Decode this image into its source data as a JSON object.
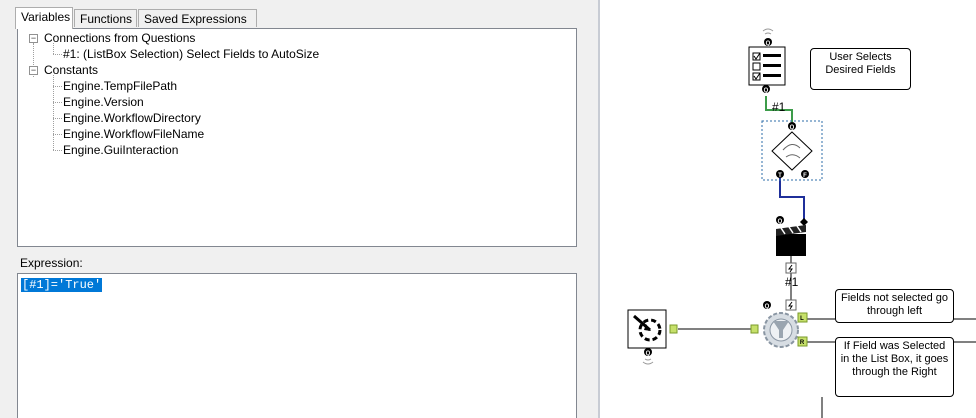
{
  "tabs": [
    {
      "label": "Variables",
      "active": true
    },
    {
      "label": "Functions",
      "active": false
    },
    {
      "label": "Saved Expressions",
      "active": false
    }
  ],
  "tree": {
    "connections_label": "Connections from Questions",
    "connection_item": "#1: (ListBox Selection) Select Fields to AutoSize",
    "constants_label": "Constants",
    "constants": [
      "Engine.TempFilePath",
      "Engine.Version",
      "Engine.WorkflowDirectory",
      "Engine.WorkflowFileName",
      "Engine.GuiInteraction"
    ],
    "expander_symbol": "⊟"
  },
  "expression": {
    "label": "Expression:",
    "value": "[#1]='True'"
  },
  "canvas": {
    "comment_user_selects": "User Selects\nDesired Fields",
    "comment_not_selected": "Fields not selected go through left",
    "comment_selected": "If Field was Selected in the List Box, it goes through the Right",
    "connection_label_1": "#1",
    "connection_label_2": "#1",
    "anchor_q": "Q",
    "anchor_t": "T",
    "anchor_f": "F",
    "anchor_l": "L",
    "anchor_r": "R",
    "accent_green": "#3d9c4a",
    "accent_blue": "#1f2f9a",
    "selection_blue": "#0078d7"
  }
}
